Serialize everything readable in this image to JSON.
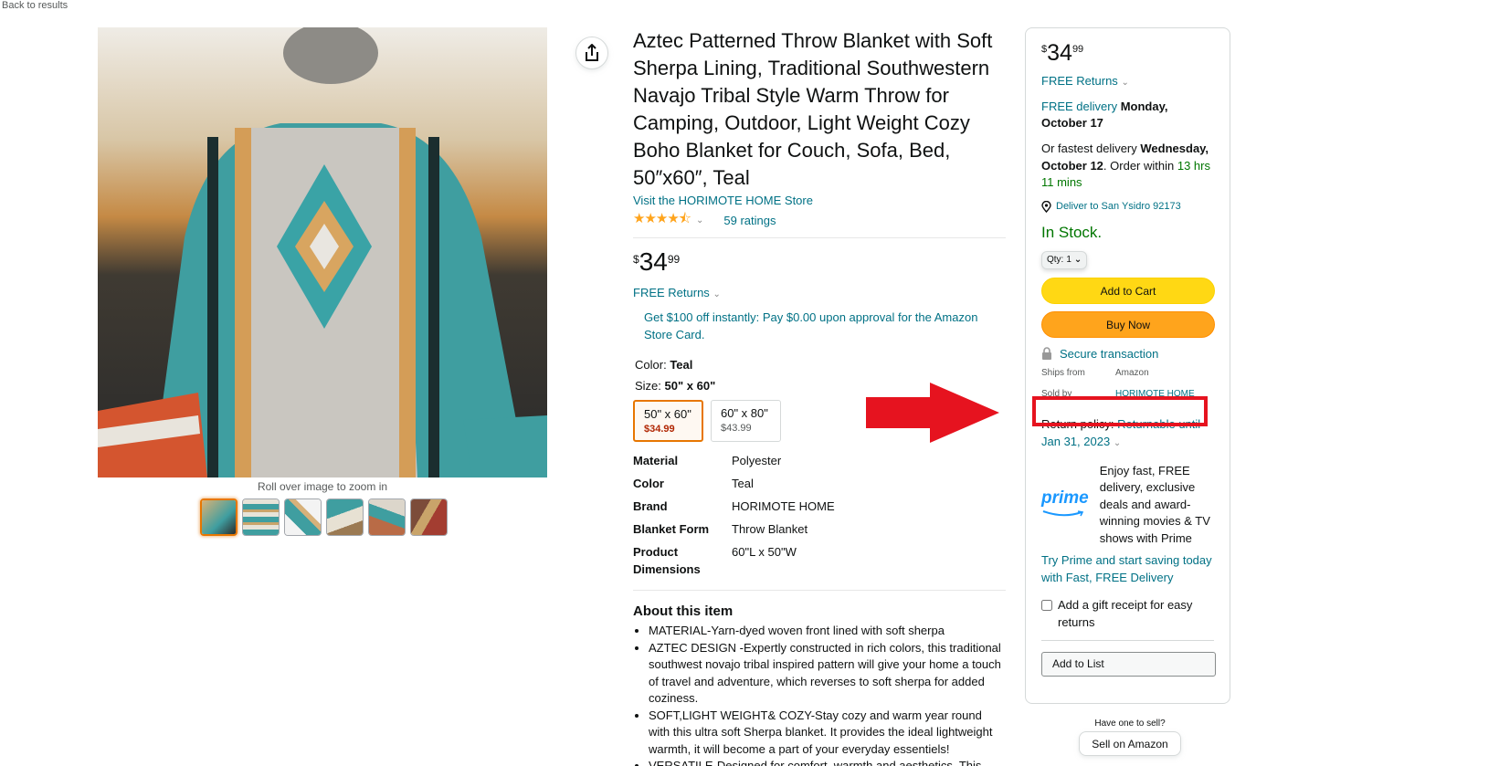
{
  "nav": {
    "back_label": "Back to results"
  },
  "gallery": {
    "zoom_hint": "Roll over image to zoom in",
    "thumbnail_count": 6
  },
  "product": {
    "title": "Aztec Patterned Throw Blanket with Soft Sherpa Lining, Traditional Southwestern Navajo Tribal Style Warm Throw for Camping, Outdoor, Light Weight Cozy Boho Blanket for Couch, Sofa, Bed, 50″x60″, Teal",
    "store_link": "Visit the HORIMOTE HOME Store",
    "rating_stars": 4.5,
    "ratings_count": "59 ratings",
    "price_symbol": "$",
    "price_whole": "34",
    "price_fraction": "99",
    "returns": "FREE Returns",
    "promo": "Get $100 off instantly: Pay $0.00 upon approval for the Amazon Store Card.",
    "color_label": "Color:",
    "color_value": "Teal",
    "size_label": "Size:",
    "size_value": "50\" x 60\"",
    "sizes": [
      {
        "label": "50\" x 60\"",
        "price": "$34.99"
      },
      {
        "label": "60\" x 80\"",
        "price": "$43.99"
      }
    ],
    "specs": [
      {
        "key": "Material",
        "value": "Polyester"
      },
      {
        "key": "Color",
        "value": "Teal"
      },
      {
        "key": "Brand",
        "value": "HORIMOTE HOME"
      },
      {
        "key": "Blanket Form",
        "value": "Throw Blanket"
      },
      {
        "key": "Product Dimensions",
        "value": "60\"L x 50\"W"
      }
    ],
    "about_title": "About this item",
    "bullets": [
      "MATERIAL-Yarn-dyed woven front lined with soft sherpa",
      "AZTEC DESIGN -Expertly constructed in rich colors, this traditional southwest novajo tribal inspired pattern will give your home a touch of travel and adventure, which reverses to soft sherpa for added coziness.",
      "SOFT,LIGHT WEIGHT& COZY-Stay cozy and warm year round with this ultra soft Sherpa blanket. It provides the ideal lightweight warmth, it will become a part of your everyday essentiels!",
      "VERSATILE-Designed for comfort, warmth and aesthetics, This"
    ]
  },
  "buybox": {
    "price_symbol": "$",
    "price_whole": "34",
    "price_fraction": "99",
    "returns": "FREE Returns",
    "free_delivery_label": "FREE delivery",
    "free_delivery_date": "Monday, October 17",
    "fastest_prefix": "Or fastest delivery",
    "fastest_date": "Wednesday, October 12",
    "order_within_prefix": ". Order within",
    "order_within_time": "13 hrs 11 mins",
    "deliver_to": "Deliver to San Ysidro 92173",
    "stock": "In Stock.",
    "qty_label": "Qty:",
    "qty_value": "1",
    "add_to_cart": "Add to Cart",
    "buy_now": "Buy Now",
    "secure": "Secure transaction",
    "ships_from_label": "Ships from",
    "ships_from_value": "Amazon",
    "sold_by_label": "Sold by",
    "sold_by_value": "HORIMOTE HOME",
    "return_policy_label": "Return policy:",
    "return_policy_value": "Returnable until Jan 31, 2023",
    "prime_logo_text": "prime",
    "prime_text": "Enjoy fast, FREE delivery, exclusive deals and award-winning movies & TV shows with Prime",
    "try_prime": "Try Prime and start saving today with Fast, FREE Delivery",
    "gift_receipt": "Add a gift receipt for easy returns",
    "add_to_list": "Add to List"
  },
  "sell": {
    "question": "Have one to sell?",
    "button": "Sell on Amazon"
  },
  "colors": {
    "link": "#007185",
    "green": "#007600",
    "cart_button": "#ffd814",
    "buy_button": "#ffa41c",
    "annotation_red": "#e6131f",
    "star": "#ffa41c"
  }
}
